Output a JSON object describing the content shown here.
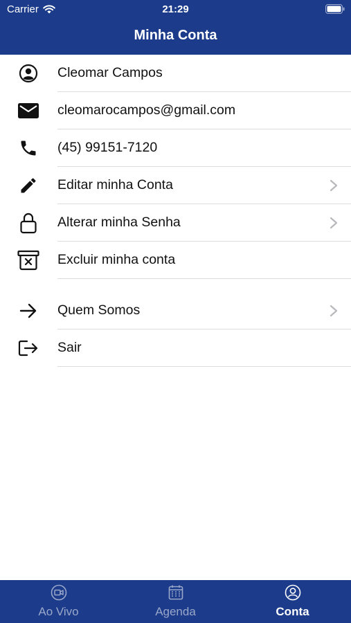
{
  "status_bar": {
    "carrier": "Carrier",
    "time": "21:29"
  },
  "header": {
    "title": "Minha Conta"
  },
  "profile": {
    "name": "Cleomar Campos",
    "email": "cleomarocampos@gmail.com",
    "phone": "(45) 99151-7120"
  },
  "menu": {
    "edit_account": "Editar minha Conta",
    "change_password": "Alterar minha Senha",
    "delete_account": "Excluir minha conta",
    "about": "Quem Somos",
    "logout": "Sair"
  },
  "tabs": [
    {
      "label": "Ao Vivo",
      "icon": "video-icon",
      "active": false
    },
    {
      "label": "Agenda",
      "icon": "calendar-icon",
      "active": false
    },
    {
      "label": "Conta",
      "icon": "account-icon",
      "active": true
    }
  ],
  "colors": {
    "primary": "#1c3c8b",
    "inactive_tab": "#9aa7c9",
    "separator": "#dcdcdc"
  }
}
